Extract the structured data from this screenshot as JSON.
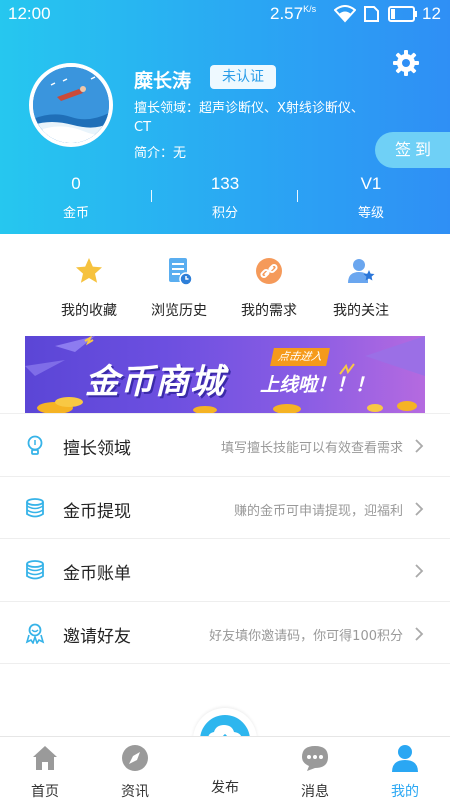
{
  "status_bar": {
    "time": "12:00",
    "speed": "2.57",
    "speed_unit": "K/s",
    "battery": "12"
  },
  "profile": {
    "name": "糜长涛",
    "cert_badge": "未认证",
    "specialty": "擅长领域：超声诊断仪、X射线诊断仪、CT",
    "intro": "简介：无",
    "checkin_label": "签到",
    "stats": [
      {
        "value": "0",
        "label": "金币"
      },
      {
        "value": "133",
        "label": "积分"
      },
      {
        "value": "V1",
        "label": "等级"
      }
    ]
  },
  "shortcuts": [
    {
      "label": "我的收藏",
      "icon": "star-icon"
    },
    {
      "label": "浏览历史",
      "icon": "history-icon"
    },
    {
      "label": "我的需求",
      "icon": "link-icon"
    },
    {
      "label": "我的关注",
      "icon": "follow-icon"
    }
  ],
  "banner": {
    "title": "金币商城",
    "badge": "点击进入",
    "subtitle": "上线啦！！！"
  },
  "menu": [
    {
      "label": "擅长领域",
      "hint": "填写擅长技能可以有效查看需求",
      "icon": "lightbulb-icon"
    },
    {
      "label": "金币提现",
      "hint": "赚的金币可申请提现，迎福利",
      "icon": "coin-stack-icon"
    },
    {
      "label": "金币账单",
      "hint": "",
      "icon": "coin-stack-icon"
    },
    {
      "label": "邀请好友",
      "hint": "好友填你邀请码，你可得100积分",
      "icon": "invite-icon"
    }
  ],
  "bottom_nav": [
    {
      "label": "首页",
      "icon": "home-icon"
    },
    {
      "label": "资讯",
      "icon": "compass-icon"
    },
    {
      "label": "发布",
      "icon": "upload-icon"
    },
    {
      "label": "消息",
      "icon": "message-icon"
    },
    {
      "label": "我的",
      "icon": "user-icon",
      "active": true
    }
  ],
  "colors": {
    "brand": "#2aa7f3",
    "header_gradient_start": "#26c7ef",
    "header_gradient_end": "#2f8ff5"
  }
}
